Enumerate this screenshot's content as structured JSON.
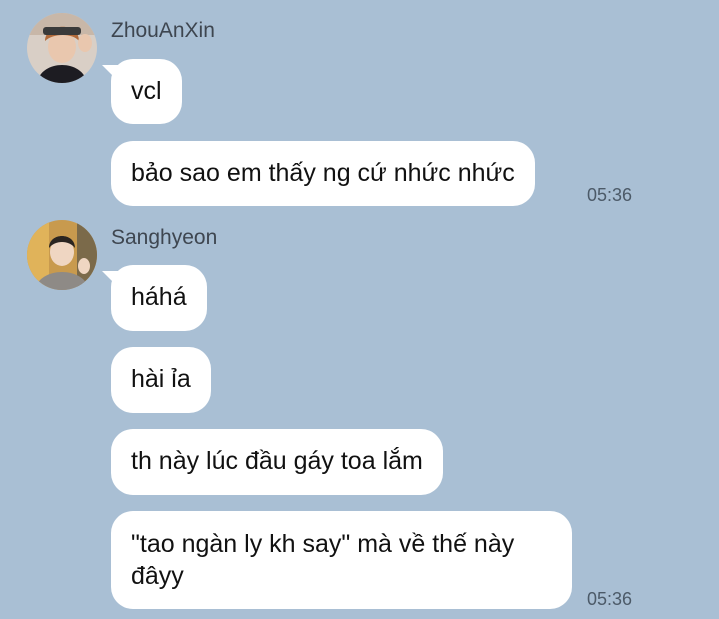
{
  "messages": [
    {
      "sender": "ZhouAnXin",
      "avatar": "user-avatar-photo",
      "bubbles": [
        "vcl",
        "bảo sao em thấy ng cứ nhức nhức"
      ],
      "time": "05:36"
    },
    {
      "sender": "Sanghyeon",
      "avatar": "user-avatar-photo",
      "bubbles": [
        "háhá",
        "hài ỉa",
        "th này lúc đầu gáy toa lắm",
        "\"tao ngàn ly kh say\" mà về thế này",
        "đâyy"
      ],
      "time": "05:36"
    }
  ]
}
